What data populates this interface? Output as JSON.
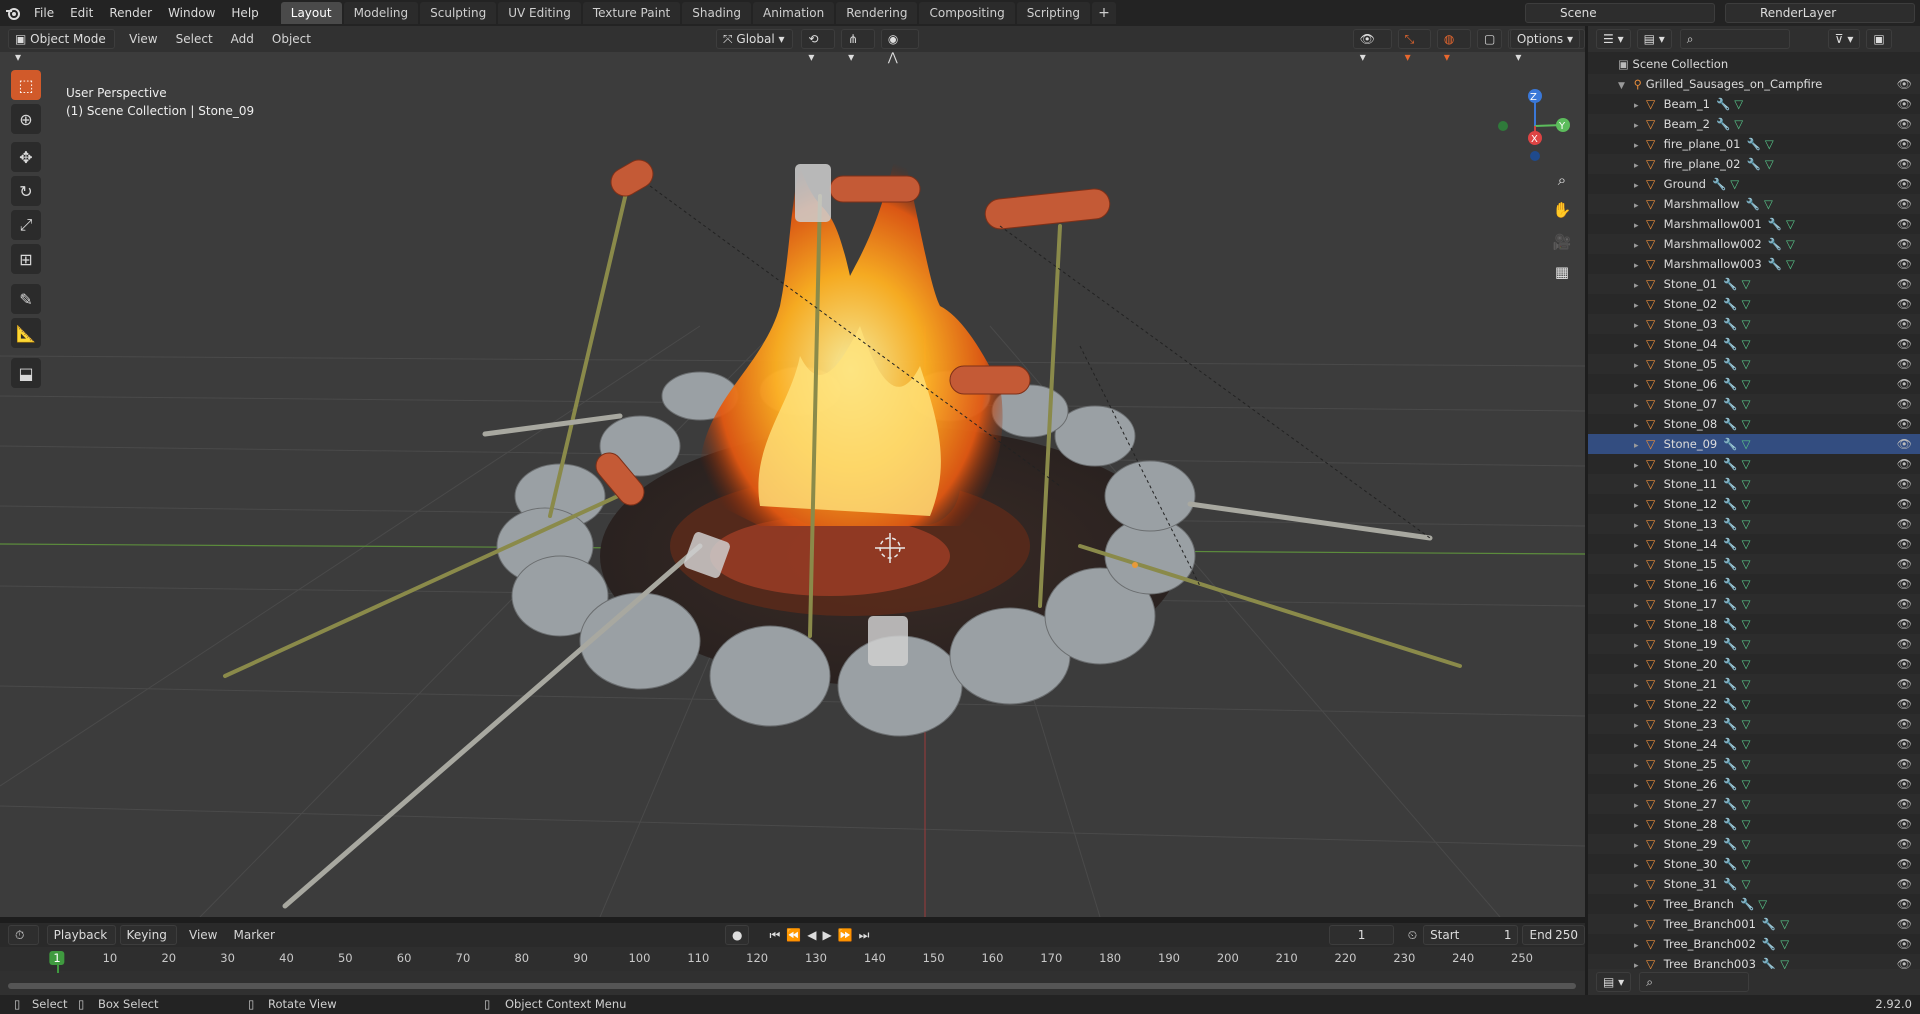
{
  "topbar": {
    "menu": [
      "File",
      "Edit",
      "Render",
      "Window",
      "Help"
    ],
    "workspaces": [
      "Layout",
      "Modeling",
      "Sculpting",
      "UV Editing",
      "Texture Paint",
      "Shading",
      "Animation",
      "Rendering",
      "Compositing",
      "Scripting"
    ],
    "active_workspace": "Layout",
    "scene": "Scene",
    "view_layer": "RenderLayer"
  },
  "viewport": {
    "mode": "Object Mode",
    "menu": [
      "View",
      "Select",
      "Add",
      "Object"
    ],
    "orientation": "Global",
    "options_label": "Options",
    "perspective_label": "User Perspective",
    "context_label": "(1) Scene Collection | Stone_09",
    "gizmo_axes": {
      "x": "X",
      "y": "Y",
      "z": "Z"
    }
  },
  "outliner": {
    "root": "Scene Collection",
    "collection": "Grilled_Sausages_on_Campfire",
    "selected_item": "Stone_09",
    "items": [
      "Beam_1",
      "Beam_2",
      "fire_plane_01",
      "fire_plane_02",
      "Ground",
      "Marshmallow",
      "Marshmallow001",
      "Marshmallow002",
      "Marshmallow003",
      "Stone_01",
      "Stone_02",
      "Stone_03",
      "Stone_04",
      "Stone_05",
      "Stone_06",
      "Stone_07",
      "Stone_08",
      "Stone_09",
      "Stone_10",
      "Stone_11",
      "Stone_12",
      "Stone_13",
      "Stone_14",
      "Stone_15",
      "Stone_16",
      "Stone_17",
      "Stone_18",
      "Stone_19",
      "Stone_20",
      "Stone_21",
      "Stone_22",
      "Stone_23",
      "Stone_24",
      "Stone_25",
      "Stone_26",
      "Stone_27",
      "Stone_28",
      "Stone_29",
      "Stone_30",
      "Stone_31",
      "Tree_Branch",
      "Tree_Branch001",
      "Tree_Branch002",
      "Tree_Branch003"
    ]
  },
  "timeline": {
    "menu": [
      "Playback",
      "Keying",
      "View",
      "Marker"
    ],
    "current_frame": "1",
    "start_label": "Start",
    "start": "1",
    "end_label": "End",
    "end": "250",
    "ruler": [
      "1",
      "10",
      "20",
      "30",
      "40",
      "50",
      "60",
      "70",
      "80",
      "90",
      "100",
      "110",
      "120",
      "130",
      "140",
      "150",
      "160",
      "170",
      "180",
      "190",
      "200",
      "210",
      "220",
      "230",
      "240",
      "250"
    ]
  },
  "statusbar": {
    "select": "Select",
    "box_select": "Box Select",
    "rotate_view": "Rotate View",
    "context_menu": "Object Context Menu",
    "version": "2.92.0"
  }
}
